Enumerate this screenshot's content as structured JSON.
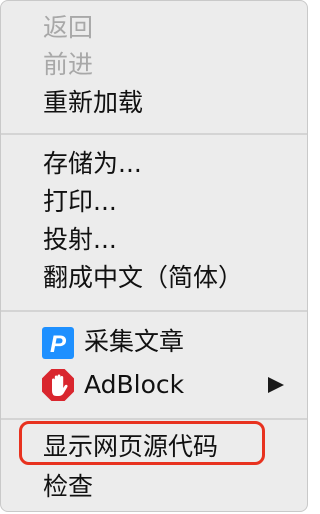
{
  "menu": {
    "back_label": "返回",
    "forward_label": "前进",
    "reload_label": "重新加载",
    "save_as_label": "存储为...",
    "print_label": "打印...",
    "cast_label": "投射...",
    "translate_label": "翻成中文（简体）",
    "extensions": [
      {
        "label": "采集文章",
        "icon": "p-icon",
        "icon_color": "#1e90ff"
      },
      {
        "label": "AdBlock",
        "icon": "adblock-hand-icon",
        "icon_color": "#d9262e"
      }
    ],
    "view_source_label": "显示网页源代码",
    "inspect_label": "检查"
  }
}
